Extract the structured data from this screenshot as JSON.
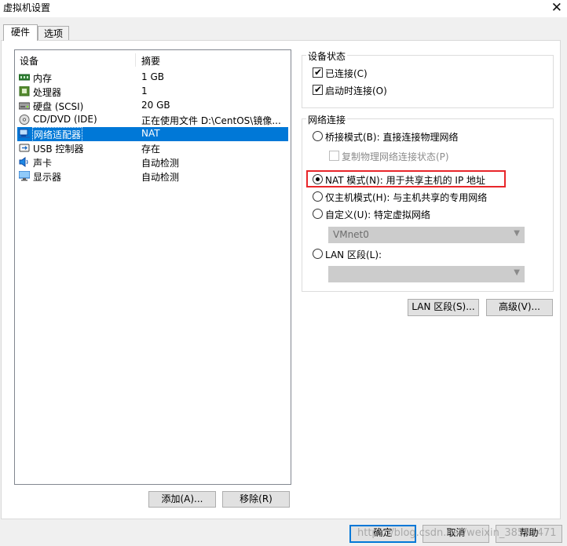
{
  "window": {
    "title": "虚拟机设置",
    "close_glyph": "✕"
  },
  "tabs": [
    {
      "label": "硬件",
      "active": true
    },
    {
      "label": "选项",
      "active": false
    }
  ],
  "device_list": {
    "columns": {
      "device": "设备",
      "summary": "摘要"
    },
    "rows": [
      {
        "icon": "memory-icon",
        "name": "内存",
        "summary": "1 GB"
      },
      {
        "icon": "processor-icon",
        "name": "处理器",
        "summary": "1"
      },
      {
        "icon": "hard-disk-icon",
        "name": "硬盘 (SCSI)",
        "summary": "20 GB"
      },
      {
        "icon": "cd-dvd-icon",
        "name": "CD/DVD (IDE)",
        "summary": "正在使用文件 D:\\CentOS\\镜像..."
      },
      {
        "icon": "network-adapter-icon",
        "name": "网络适配器",
        "summary": "NAT",
        "selected": true
      },
      {
        "icon": "usb-icon",
        "name": "USB 控制器",
        "summary": "存在"
      },
      {
        "icon": "sound-card-icon",
        "name": "声卡",
        "summary": "自动检测"
      },
      {
        "icon": "display-icon",
        "name": "显示器",
        "summary": "自动检测"
      }
    ],
    "add_label": "添加(A)...",
    "remove_label": "移除(R)"
  },
  "device_status": {
    "title": "设备状态",
    "connected": {
      "label": "已连接(C)",
      "checked": true
    },
    "connect_at_power_on": {
      "label": "启动时连接(O)",
      "checked": true
    }
  },
  "network_connection": {
    "title": "网络连接",
    "bridged": {
      "label": "桥接模式(B): 直接连接物理网络",
      "selected": false
    },
    "replicate": {
      "label": "复制物理网络连接状态(P)",
      "checked": false,
      "enabled": false
    },
    "nat": {
      "label": "NAT 模式(N): 用于共享主机的 IP 地址",
      "selected": true
    },
    "host_only": {
      "label": "仅主机模式(H): 与主机共享的专用网络",
      "selected": false
    },
    "custom": {
      "label": "自定义(U): 特定虚拟网络",
      "selected": false
    },
    "custom_network_value": "VMnet0",
    "lan_segment": {
      "label": "LAN 区段(L):",
      "selected": false
    },
    "lan_segment_value": ""
  },
  "buttons": {
    "lan_segments": "LAN 区段(S)...",
    "advanced": "高级(V)...",
    "ok": "确定",
    "cancel": "取消",
    "help": "帮助"
  },
  "watermark": "https://blog.csdn.net/weixin_38531471",
  "colors": {
    "selection": "#0078d7",
    "highlight_box": "#e8262a",
    "default_button_border": "#0078d7"
  }
}
